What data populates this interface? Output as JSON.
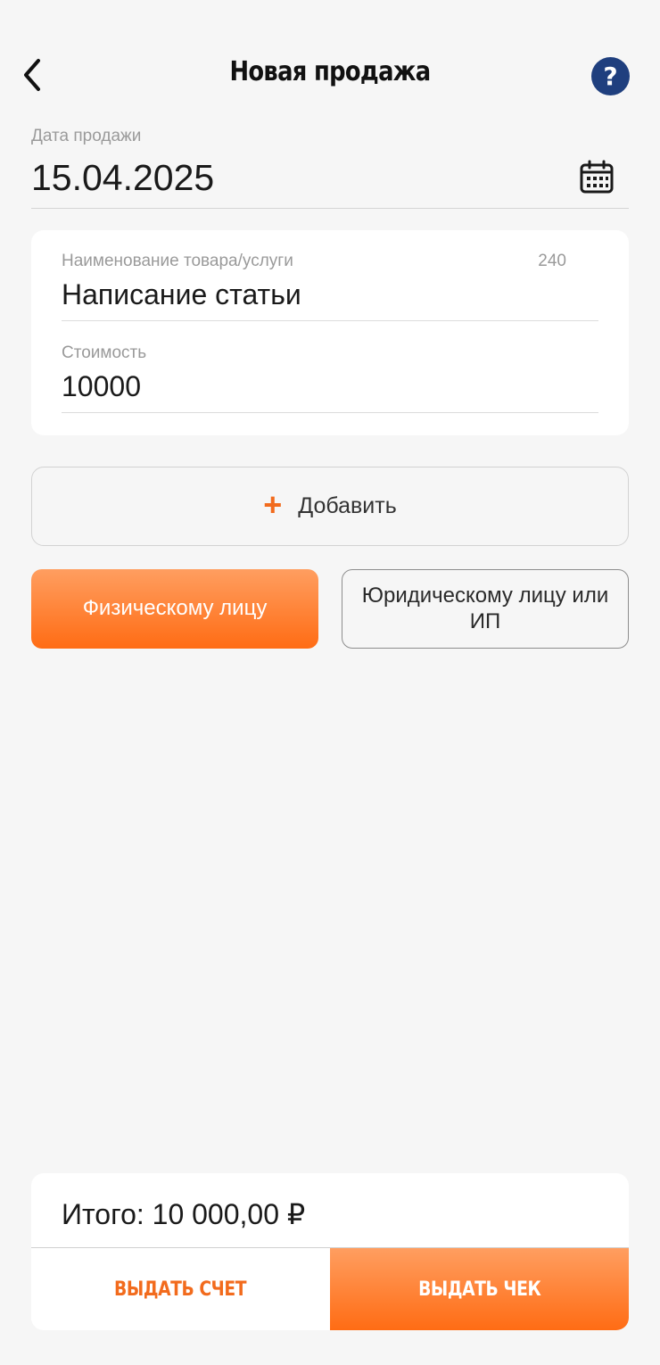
{
  "header": {
    "title": "Новая продажа",
    "help_label": "?"
  },
  "sale_date": {
    "label": "Дата продажи",
    "value": "15.04.2025"
  },
  "item": {
    "name_label": "Наименование товара/услуги",
    "name_counter": "240",
    "name_value": "Написание статьи",
    "price_label": "Стоимость",
    "price_value": "10000"
  },
  "add_button": {
    "icon": "+",
    "label": "Добавить"
  },
  "client_type": {
    "individual_label": "Физическому лицу",
    "legal_label": "Юридическому лицу или ИП",
    "selected": "individual"
  },
  "summary": {
    "total_text": "Итого: 10 000,00 ₽"
  },
  "actions": {
    "invoice_label": "ВЫДАТЬ СЧЕТ",
    "receipt_label": "ВЫДАТЬ ЧЕК"
  },
  "colors": {
    "accent": "#ff6c14",
    "accent_light": "#ff9e60",
    "help_bg": "#1f3f7e",
    "background": "#f6f6f6"
  }
}
